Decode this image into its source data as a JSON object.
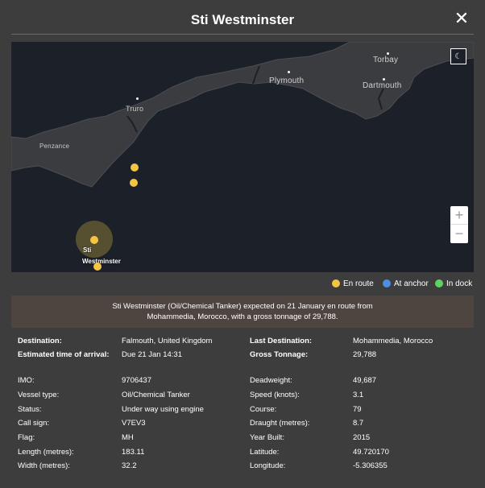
{
  "modal": {
    "title": "Sti Westminster",
    "close_symbol": "✕"
  },
  "map": {
    "places": {
      "torbay": "Torbay",
      "plymouth": "Plymouth",
      "dartmouth": "Dartmouth",
      "truro": "Truro",
      "penzance": "Penzance"
    },
    "vessel_label": "Sti Westminster",
    "vessel_label_line1": "Sti",
    "vessel_label_line2": "Westminster",
    "zoom_in": "+",
    "zoom_out": "−",
    "theme_icon": "☾"
  },
  "legend": {
    "en_route": {
      "label": "En route",
      "color": "#f4c542"
    },
    "at_anchor": {
      "label": "At anchor",
      "color": "#4a90e2"
    },
    "in_dock": {
      "label": "In dock",
      "color": "#5fd35f"
    }
  },
  "summary": "Sti Westminster (Oil/Chemical Tanker) expected on 21 January en route from Mohammedia, Morocco, with a gross tonnage of 29,788.",
  "details": {
    "destination": {
      "label": "Destination:",
      "value": "Falmouth, United Kingdom"
    },
    "last_destination": {
      "label": "Last Destination:",
      "value": "Mohammedia, Morocco"
    },
    "eta": {
      "label": "Estimated time of arrival:",
      "value": "Due 21 Jan 14:31"
    },
    "gross_tonnage": {
      "label": "Gross Tonnage:",
      "value": "29,788"
    },
    "imo": {
      "label": "IMO:",
      "value": "9706437"
    },
    "deadweight": {
      "label": "Deadweight:",
      "value": "49,687"
    },
    "vessel_type": {
      "label": "Vessel type:",
      "value": "Oil/Chemical Tanker"
    },
    "speed": {
      "label": "Speed (knots):",
      "value": "3.1"
    },
    "status": {
      "label": "Status:",
      "value": "Under way using engine"
    },
    "course": {
      "label": "Course:",
      "value": "79"
    },
    "call_sign": {
      "label": "Call sign:",
      "value": "V7EV3"
    },
    "draught": {
      "label": "Draught (metres):",
      "value": "8.7"
    },
    "flag": {
      "label": "Flag:",
      "value": "MH"
    },
    "year_built": {
      "label": "Year Built:",
      "value": "2015"
    },
    "length": {
      "label": "Length (metres):",
      "value": "183.11"
    },
    "latitude": {
      "label": "Latitude:",
      "value": "49.720170"
    },
    "width": {
      "label": "Width (metres):",
      "value": "32.2"
    },
    "longitude": {
      "label": "Longitude:",
      "value": "-5.306355"
    }
  },
  "colors": {
    "background": "#3d3d3d",
    "map_sea": "#1b2029",
    "map_land": "#3a3c40",
    "summary_bg": "#4e4440",
    "vessel": "#f4c542"
  }
}
